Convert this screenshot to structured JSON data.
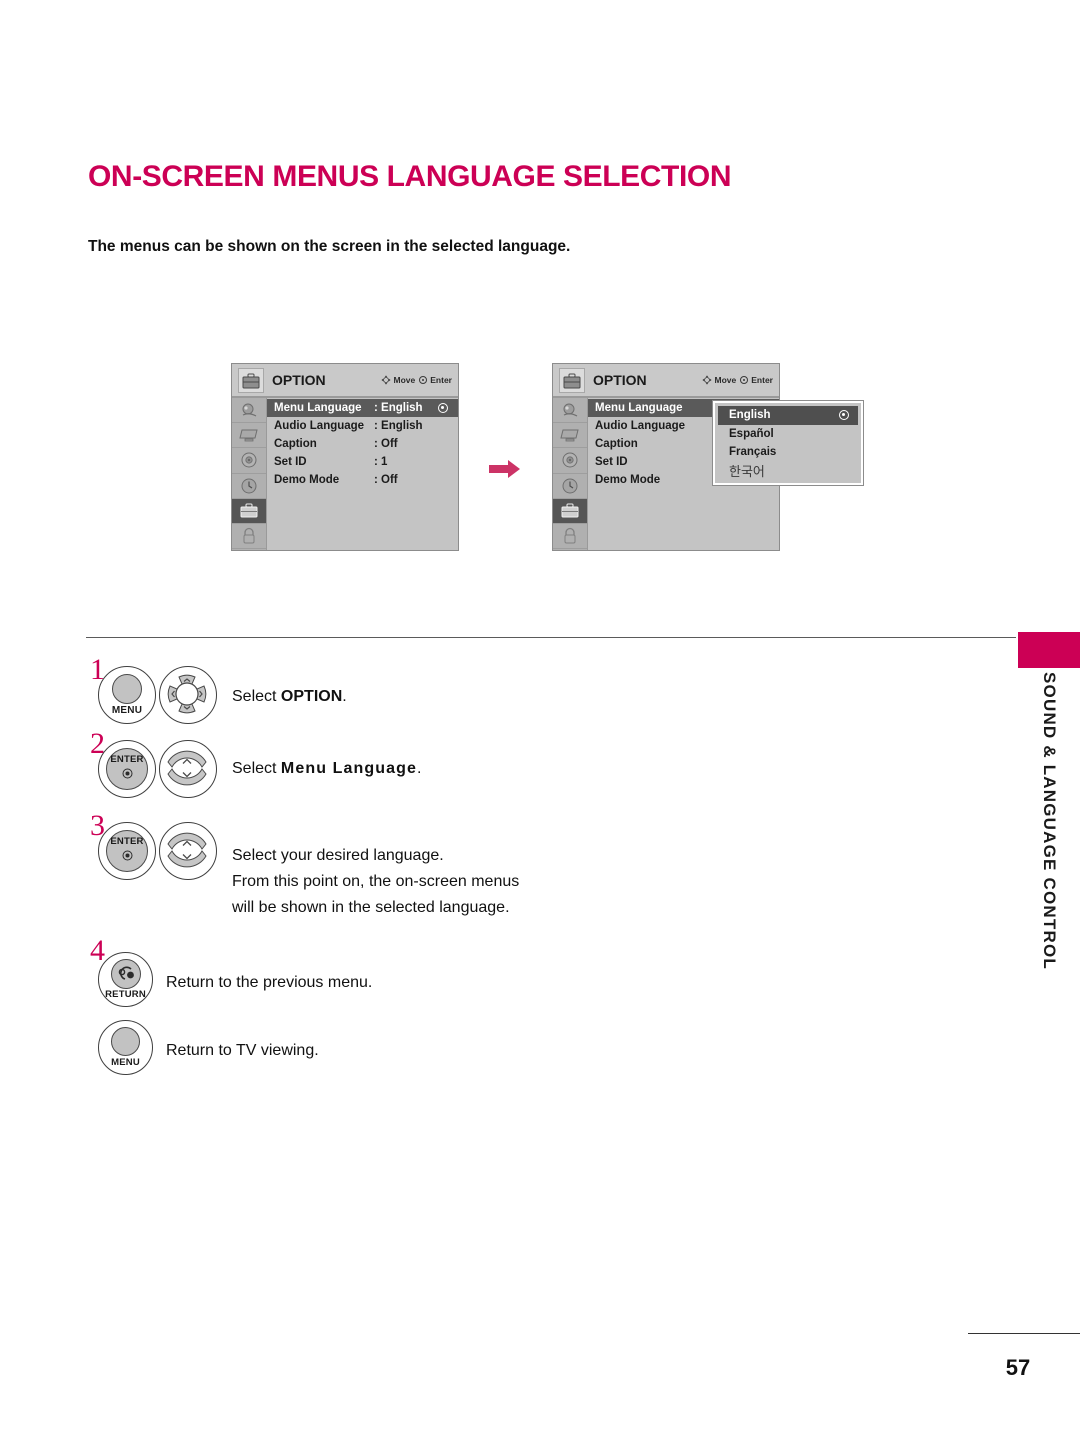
{
  "page": {
    "title": "ON-SCREEN MENUS LANGUAGE SELECTION",
    "intro": "The menus can be shown on the screen in the selected language.",
    "number": "57",
    "side_tab": "SOUND & LANGUAGE CONTROL",
    "accent_color": "#cc0055"
  },
  "osd": {
    "title": "OPTION",
    "hint_move": "Move",
    "hint_enter": "Enter",
    "rail_icons": [
      "picture-icon",
      "screen-icon",
      "audio-icon",
      "time-icon",
      "option-icon",
      "lock-icon"
    ],
    "rows": [
      {
        "label": "Menu Language",
        "value": ": English"
      },
      {
        "label": "Audio Language",
        "value": ": English"
      },
      {
        "label": "Caption",
        "value": ": Off"
      },
      {
        "label": "Set ID",
        "value": ": 1"
      },
      {
        "label": "Demo Mode",
        "value": ": Off"
      }
    ],
    "selected_row": "Menu Language"
  },
  "dropdown": {
    "options": [
      "English",
      "Español",
      "Français",
      "한국어"
    ],
    "selected": "English"
  },
  "steps": [
    {
      "number": "1",
      "buttons": [
        "MENU",
        "dpad-4way"
      ],
      "text_prefix": "Select ",
      "text_bold": "OPTION",
      "text_suffix": "."
    },
    {
      "number": "2",
      "buttons": [
        "ENTER",
        "updown-arrows"
      ],
      "text_prefix": "Select ",
      "text_bold": "Menu Language",
      "text_suffix": "."
    },
    {
      "number": "3",
      "buttons": [
        "ENTER",
        "updown-arrows"
      ],
      "line1": "Select your desired language.",
      "line2": "From this point on, the on-screen menus",
      "line3": "will be shown in the selected language."
    },
    {
      "number": "4",
      "buttons": [
        "RETURN"
      ],
      "text": "Return to the previous menu."
    },
    {
      "number": "",
      "buttons": [
        "MENU"
      ],
      "text": "Return to TV viewing."
    }
  ],
  "button_labels": {
    "menu": "MENU",
    "enter": "ENTER",
    "return": "RETURN"
  }
}
